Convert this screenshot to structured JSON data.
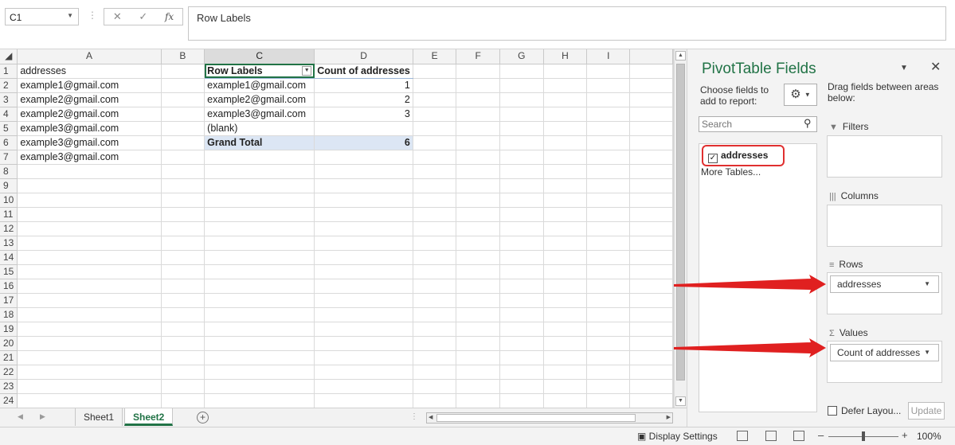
{
  "formula_bar": {
    "name_box": "C1",
    "formula": "Row Labels",
    "cancel_glyph": "✕",
    "enter_glyph": "✓",
    "fx_glyph": "fx"
  },
  "columns": [
    "A",
    "B",
    "C",
    "D",
    "E",
    "F",
    "G",
    "H",
    "I"
  ],
  "rows": [
    {
      "n": "1",
      "a": "addresses",
      "c": "Row Labels",
      "d": "Count of addresses"
    },
    {
      "n": "2",
      "a": "example1@gmail.com",
      "c": "example1@gmail.com",
      "d": "1"
    },
    {
      "n": "3",
      "a": "example2@gmail.com",
      "c": "example2@gmail.com",
      "d": "2"
    },
    {
      "n": "4",
      "a": "example2@gmail.com",
      "c": "example3@gmail.com",
      "d": "3"
    },
    {
      "n": "5",
      "a": "example3@gmail.com",
      "c": "(blank)",
      "d": ""
    },
    {
      "n": "6",
      "a": "example3@gmail.com",
      "c": "Grand Total",
      "d": "6"
    },
    {
      "n": "7",
      "a": "example3@gmail.com",
      "c": "",
      "d": ""
    },
    {
      "n": "8"
    },
    {
      "n": "9"
    },
    {
      "n": "10"
    },
    {
      "n": "11"
    },
    {
      "n": "12"
    },
    {
      "n": "13"
    },
    {
      "n": "14"
    },
    {
      "n": "15"
    },
    {
      "n": "16"
    },
    {
      "n": "17"
    },
    {
      "n": "18"
    },
    {
      "n": "19"
    },
    {
      "n": "20"
    },
    {
      "n": "21"
    },
    {
      "n": "22"
    },
    {
      "n": "23"
    },
    {
      "n": "24"
    }
  ],
  "sheet_tabs": [
    "Sheet1",
    "Sheet2"
  ],
  "active_sheet": "Sheet2",
  "add_sheet_glyph": "+",
  "tabs_more": "⋮",
  "status": {
    "display_settings": "Display Settings",
    "zoom_minus": "–",
    "zoom_plus": "+",
    "zoom": "100%",
    "zoom_level": 0.5
  },
  "pivot_panel": {
    "title": "PivotTable Fields",
    "choose": "Choose fields to add to report:",
    "search_placeholder": "Search",
    "field": "addresses",
    "field_checked": "✓",
    "more_tables": "More Tables...",
    "drag_hint": "Drag fields between areas below:",
    "filters_label": "Filters",
    "columns_label": "Columns",
    "rows_label": "Rows",
    "values_label": "Values",
    "rows_field": "addresses",
    "values_field": "Count of addresses",
    "defer": "Defer Layou...",
    "update": "Update"
  },
  "colors": {
    "accent": "#217346",
    "highlight_red": "#e03030",
    "pivot_total_bg": "#dce6f4"
  }
}
